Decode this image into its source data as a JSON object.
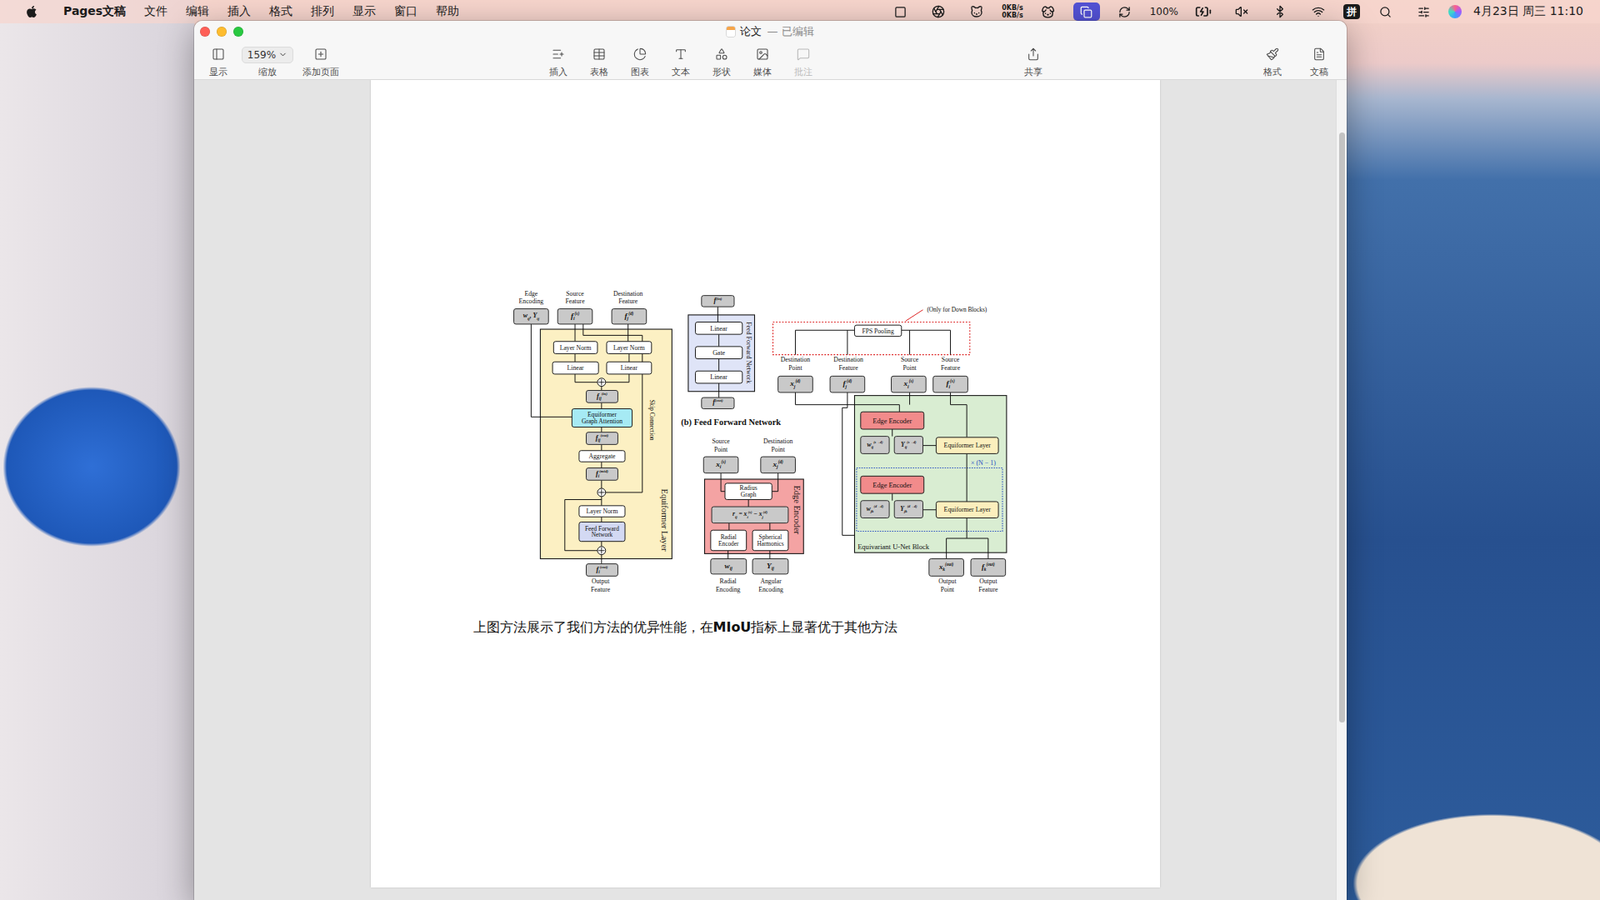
{
  "menubar": {
    "app": "Pages文稿",
    "menus": [
      "文件",
      "编辑",
      "插入",
      "格式",
      "排列",
      "显示",
      "窗口",
      "帮助"
    ],
    "network": [
      "0KB/s",
      "0KB/s"
    ],
    "screen_mirroring": {
      "selected": true
    },
    "battery": "100%",
    "input_method": "拼",
    "clock": "4月23日 周三 11:10"
  },
  "window": {
    "title": "论文",
    "subtitle": "— 已编辑"
  },
  "toolbar": {
    "left": [
      {
        "label": "显示"
      },
      {
        "label": "缩放",
        "value": "159%"
      },
      {
        "label": "添加页面"
      }
    ],
    "center": [
      {
        "label": "插入",
        "disabled": false
      },
      {
        "label": "表格",
        "disabled": false
      },
      {
        "label": "图表",
        "disabled": false
      },
      {
        "label": "文本",
        "disabled": false
      },
      {
        "label": "形状",
        "disabled": false
      },
      {
        "label": "媒体",
        "disabled": false
      },
      {
        "label": "批注",
        "disabled": true
      }
    ],
    "share": {
      "label": "共享"
    },
    "right": [
      {
        "label": "格式"
      },
      {
        "label": "文稿"
      }
    ]
  },
  "scrollbar": {
    "level": 0.72
  },
  "document": {
    "figure": {
      "tensors": [
        {
          "math": [
            {
              "base": "w",
              "sub": "ij"
            },
            {
              "base": ", Y",
              "sub": "ij"
            }
          ]
        },
        {
          "math": [
            {
              "base": "f",
              "sub": "i",
              "sup": "(s)"
            }
          ]
        },
        {
          "math": [
            {
              "base": "f",
              "sub": "j",
              "sup": "(d)"
            }
          ]
        },
        {
          "math": [
            {
              "base": "f",
              "sub": "ij",
              "sup": "(in)"
            }
          ]
        },
        {
          "math": [
            {
              "base": "f",
              "sub": "ij",
              "sup": "(out)"
            }
          ]
        },
        {
          "math": [
            {
              "base": "f",
              "sub": "i",
              "sup": "(mid)"
            }
          ]
        },
        {
          "math": [
            {
              "base": "f",
              "sub": "i",
              "sup": "(out)"
            }
          ]
        },
        {
          "math": [
            {
              "base": "f",
              "sup": "(in)"
            }
          ]
        },
        {
          "math": [
            {
              "base": "f",
              "sup": "(out)"
            }
          ]
        },
        {
          "math": [
            {
              "base": "x",
              "sub": "i",
              "sup": "(s)"
            }
          ]
        },
        {
          "math": [
            {
              "base": "x",
              "sub": "j",
              "sup": "(d)"
            }
          ]
        },
        {
          "math": [
            {
              "base": "r",
              "sub": "ij"
            },
            {
              "base": " = x",
              "sub": "i",
              "sup": "(s)"
            },
            {
              "base": " − x",
              "sub": "j",
              "sup": "(d)"
            }
          ]
        },
        {
          "math": [
            {
              "base": "w",
              "sub": "ij"
            }
          ]
        },
        {
          "math": [
            {
              "base": "Y",
              "sub": "ij"
            }
          ]
        },
        {
          "math": [
            {
              "base": "x",
              "sub": "j",
              "sup": "(d)"
            }
          ]
        },
        {
          "math": [
            {
              "base": "f",
              "sub": "j",
              "sup": "(d)"
            }
          ]
        },
        {
          "math": [
            {
              "base": "x",
              "sub": "i",
              "sup": "(s)"
            }
          ]
        },
        {
          "math": [
            {
              "base": "f",
              "sub": "i",
              "sup": "(s)"
            }
          ]
        },
        {
          "math": [
            {
              "base": "w",
              "sub": "ij",
              "sup": "(s→d)"
            }
          ]
        },
        {
          "math": [
            {
              "base": "Y",
              "sub": "ij",
              "sup": "(s→d)"
            }
          ]
        },
        {
          "math": [
            {
              "base": "w",
              "sub": "jk",
              "sup": "(d→d)"
            }
          ]
        },
        {
          "math": [
            {
              "base": "Y",
              "sub": "jk",
              "sup": "(d→d)"
            }
          ]
        },
        {
          "math": [
            {
              "base": "x",
              "sub": "k",
              "sup": "(out)"
            }
          ]
        },
        {
          "math": [
            {
              "base": "f",
              "sub": "k",
              "sup": "(out)"
            }
          ]
        }
      ],
      "blocks": [
        {
          "lines": [
            "Layer Norm"
          ],
          "color": "#ffffff"
        },
        {
          "lines": [
            "Layer Norm"
          ],
          "color": "#ffffff"
        },
        {
          "lines": [
            "Linear"
          ],
          "color": "#ffffff"
        },
        {
          "lines": [
            "Linear"
          ],
          "color": "#ffffff"
        },
        {
          "lines": [
            "Equiformer",
            "Graph Attention"
          ],
          "color": "#a6eaf4"
        },
        {
          "lines": [
            "Aggregate"
          ],
          "color": "#ffffff"
        },
        {
          "lines": [
            "Layer Norm"
          ],
          "color": "#ffffff"
        },
        {
          "lines": [
            "Feed Forward",
            "Network"
          ],
          "color": "#d3d9f3"
        },
        {
          "lines": [
            "Linear"
          ],
          "color": "#ffffff"
        },
        {
          "lines": [
            "Gate"
          ],
          "color": "#ffffff"
        },
        {
          "lines": [
            "Linear"
          ],
          "color": "#ffffff"
        },
        {
          "lines": [
            "Radius",
            "Graph"
          ],
          "color": "#ffffff"
        },
        {
          "lines": [
            "Radial",
            "Encoder"
          ],
          "color": "#ffffff"
        },
        {
          "lines": [
            "Spherical",
            "Harmonics"
          ],
          "color": "#ffffff"
        },
        {
          "lines": [
            "FPS Pooling"
          ],
          "color": "#ffffff"
        },
        {
          "lines": [
            "Edge Encoder"
          ],
          "color": "#f28b8b"
        },
        {
          "lines": [
            "Equiformer Layer"
          ],
          "color": "#fbefbd"
        },
        {
          "lines": [
            "Edge Encoder"
          ],
          "color": "#f28b8b"
        },
        {
          "lines": [
            "Equiformer Layer"
          ],
          "color": "#fbefbd"
        }
      ],
      "labels": [
        {
          "lines": [
            "Edge",
            "Encoding"
          ]
        },
        {
          "lines": [
            "Source",
            "Feature"
          ]
        },
        {
          "lines": [
            "Destination",
            "Feature"
          ]
        },
        {
          "lines": [
            "Output",
            "Feature"
          ]
        },
        {
          "lines": [
            "Source",
            "Point"
          ]
        },
        {
          "lines": [
            "Destination",
            "Point"
          ]
        },
        {
          "lines": [
            "Radial",
            "Encoding"
          ]
        },
        {
          "lines": [
            "Angular",
            "Encoding"
          ]
        },
        {
          "lines": [
            "Destination",
            "Point"
          ]
        },
        {
          "lines": [
            "Destination",
            "Feature"
          ]
        },
        {
          "lines": [
            "Source",
            "Point"
          ]
        },
        {
          "lines": [
            "Source",
            "Feature"
          ]
        },
        {
          "lines": [
            "Output",
            "Point"
          ]
        },
        {
          "lines": [
            "Output",
            "Feature"
          ]
        }
      ],
      "vertical_labels": [
        "Skip Connection",
        "Equiformer Layer",
        "Feed Forward Network",
        "Edge Encoder"
      ],
      "titles": [
        "(b) Feed Forward Network",
        "Equivariant U-Net Block",
        "× (N − 1)",
        "(Only for Down Blocks)"
      ]
    },
    "caption": [
      {
        "text": "上图方法展示了我们方法的优异性能，在",
        "bold": false
      },
      {
        "text": "MIoU",
        "bold": true
      },
      {
        "text": "指标上显著优于其他方法",
        "bold": false
      }
    ]
  }
}
